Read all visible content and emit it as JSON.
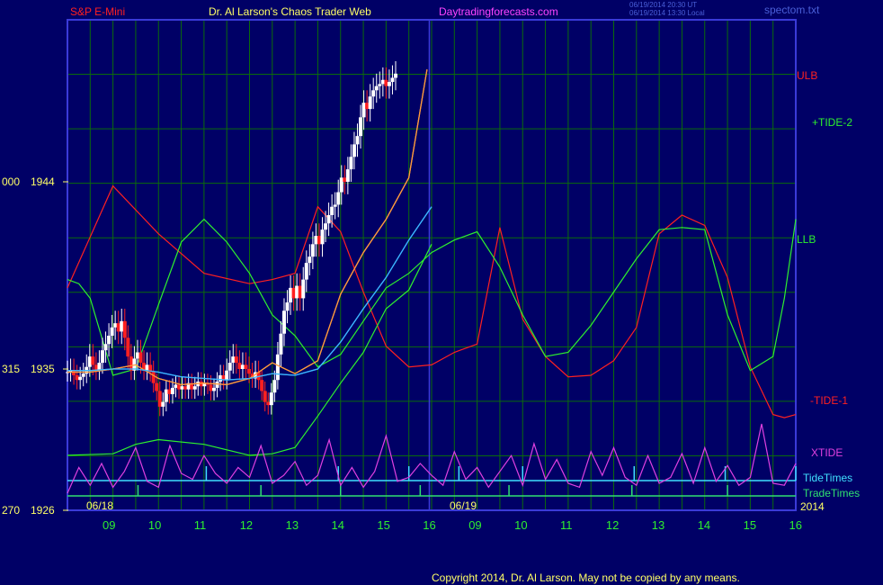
{
  "header": {
    "symbol": "S&P E-Mini",
    "site_title": "Dr. Al Larson's Chaos Trader Web",
    "url": "Daytradingforecasts.com",
    "timestamp_ut": "06/19/2014 20:30 UT",
    "timestamp_local": "06/19/2014 13:30 Local",
    "file": "spectom.txt"
  },
  "footer": {
    "copyright": "Copyright 2014, Dr. Al Larson. May not be copied by any means."
  },
  "colors": {
    "background": "#000066",
    "grid": "#0b6b0b",
    "frame": "#3a3ad8",
    "ulb": "#ff2020",
    "tide": "#2ef02e",
    "xtide": "#e040e0",
    "tide_times": "#40e0ff",
    "trade_times": "#30e070",
    "ma_fast": "#ff9a3c",
    "ma_slow": "#3cb6ff",
    "candle_up": "#ffffff",
    "candle_down": "#ff2020"
  },
  "chart_data": {
    "type": "line",
    "title": "S&P E-Mini",
    "y_ticks": [
      {
        "left": "000",
        "price": "1944",
        "value": 1944
      },
      {
        "left": "315",
        "price": "1935",
        "value": 1935
      },
      {
        "left": "270",
        "price": "1926",
        "value": 1926
      }
    ],
    "ylim": [
      1926,
      1944
    ],
    "date_labels": [
      "06/18",
      "06/19",
      "2014"
    ],
    "hour_labels": [
      "09",
      "10",
      "11",
      "12",
      "13",
      "14",
      "15",
      "16",
      "09",
      "10",
      "11",
      "12",
      "13",
      "14",
      "15",
      "16"
    ],
    "legend": [
      "ULB",
      "+TIDE-2",
      "LLB",
      "-TIDE-1",
      "XTIDE",
      "TideTimes",
      "TradeTimes"
    ],
    "series": [
      {
        "name": "ULB",
        "color": "#ff2020",
        "x": [
          0,
          1,
          2,
          3,
          4,
          4.5,
          5,
          5.5,
          6,
          6.5,
          7,
          7.5,
          8,
          8.5,
          9,
          9.5,
          10,
          10.5,
          11,
          11.5,
          12,
          12.5,
          13,
          13.5,
          14,
          14.5,
          15,
          15.5,
          15.75,
          16
        ],
        "y": [
          1938.9,
          1943.8,
          1941.5,
          1939.6,
          1939.1,
          1939.3,
          1939.6,
          1942.8,
          1941.6,
          1938.7,
          1936.1,
          1935.1,
          1935.2,
          1935.8,
          1936.2,
          1941.8,
          1937.4,
          1935.6,
          1934.5,
          1934.6,
          1935.4,
          1937.0,
          1941.5,
          1942.4,
          1941.9,
          1939.4,
          1935.1,
          1932.1,
          1931.9,
          1932.1
        ]
      },
      {
        "name": "+TIDE-2",
        "color": "#2ef02e",
        "x": [
          0,
          0.25,
          0.5,
          1,
          1.5,
          2,
          2.5,
          3,
          3.5,
          4,
          4.5,
          5,
          5.5,
          6,
          6.5,
          7,
          7.5,
          8,
          8.5,
          9,
          9.5,
          10,
          10.5,
          11,
          11.5,
          12,
          12.5,
          13,
          13.5,
          14,
          14.5,
          15,
          15.5,
          15.75,
          16
        ],
        "y": [
          1939.3,
          1939.1,
          1938.4,
          1934.6,
          1935.0,
          1938.1,
          1941.1,
          1942.2,
          1941.1,
          1939.6,
          1937.6,
          1936.6,
          1935.1,
          1935.7,
          1937.3,
          1938.9,
          1939.6,
          1940.6,
          1941.2,
          1941.6,
          1939.9,
          1937.6,
          1935.6,
          1935.8,
          1937.1,
          1938.7,
          1940.3,
          1941.7,
          1941.8,
          1941.7,
          1937.6,
          1934.9,
          1935.6,
          1938.4,
          1942.2
        ]
      },
      {
        "name": "LLB",
        "color": "#2ef02e",
        "x": [
          0,
          1,
          1.5,
          2,
          3,
          4,
          4.5,
          5,
          5.5,
          6,
          6.5,
          7,
          7.5,
          8
        ],
        "y": [
          1929.5,
          1929.6,
          1930.2,
          1930.5,
          1930.2,
          1929.5,
          1929.6,
          1930.0,
          1932.0,
          1934.1,
          1935.8,
          1937.9,
          1938.8,
          1941.0
        ]
      },
      {
        "name": "MA fast",
        "color": "#ff9a3c",
        "x": [
          0,
          0.5,
          1,
          1.5,
          2,
          2.5,
          3,
          3.5,
          4,
          4.5,
          5,
          5.5,
          5.75,
          6,
          6.5,
          7,
          7.5,
          7.9
        ],
        "y": [
          1934.8,
          1934.8,
          1935.0,
          1935.2,
          1934.4,
          1934.0,
          1934.1,
          1934.0,
          1934.4,
          1935.3,
          1934.7,
          1935.4,
          1937.0,
          1938.6,
          1940.6,
          1942.2,
          1944.2,
          1949.4
        ]
      },
      {
        "name": "MA slow",
        "color": "#3cb6ff",
        "x": [
          0,
          0.5,
          1,
          1.5,
          2,
          2.5,
          3,
          3.5,
          4,
          4.5,
          5,
          5.5,
          6,
          6.5,
          7,
          7.5,
          8
        ],
        "y": [
          1934.9,
          1934.9,
          1935.0,
          1935.0,
          1934.8,
          1934.5,
          1934.4,
          1934.3,
          1934.4,
          1934.7,
          1934.6,
          1935.0,
          1936.3,
          1937.9,
          1939.4,
          1941.2,
          1942.8
        ]
      },
      {
        "name": "XTIDE",
        "color": "#e040e0",
        "x": [
          0,
          0.25,
          0.5,
          0.75,
          1,
          1.25,
          1.5,
          1.75,
          2,
          2.25,
          2.5,
          2.75,
          3,
          3.25,
          3.5,
          3.75,
          4,
          4.25,
          4.5,
          4.75,
          5,
          5.25,
          5.5,
          5.75,
          6,
          6.25,
          6.5,
          6.75,
          7,
          7.25,
          7.5,
          7.75,
          8,
          8.25,
          8.5,
          8.75,
          9,
          9.25,
          9.5,
          9.75,
          10,
          10.25,
          10.5,
          10.75,
          11,
          11.25,
          11.5,
          11.75,
          12,
          12.25,
          12.5,
          12.75,
          13,
          13.25,
          13.5,
          13.75,
          14,
          14.25,
          14.5,
          14.75,
          15,
          15.25,
          15.5,
          15.75,
          16
        ],
        "y": [
          1926.5,
          1927.8,
          1926.9,
          1928.0,
          1926.8,
          1927.6,
          1928.8,
          1927.1,
          1926.8,
          1928.9,
          1927.5,
          1927.2,
          1928.4,
          1927.5,
          1927.0,
          1927.8,
          1927.3,
          1928.9,
          1927.0,
          1927.4,
          1928.1,
          1926.9,
          1927.4,
          1929.2,
          1926.9,
          1927.8,
          1926.8,
          1927.6,
          1929.4,
          1927.1,
          1927.3,
          1928.0,
          1927.4,
          1926.9,
          1928.6,
          1927.2,
          1927.8,
          1926.8,
          1927.6,
          1928.4,
          1926.9,
          1929.0,
          1927.2,
          1928.2,
          1927.0,
          1926.8,
          1928.6,
          1927.4,
          1928.8,
          1927.3,
          1926.9,
          1928.4,
          1927.0,
          1927.3,
          1928.5,
          1927.0,
          1928.8,
          1927.1,
          1927.9,
          1926.9,
          1927.3,
          1930.0,
          1927.0,
          1926.9,
          1928.0
        ]
      }
    ],
    "tide_times": [
      3.05,
      5.95,
      7.5,
      8.6,
      10.0,
      12.45,
      14.45,
      16.0
    ],
    "trade_times": [
      1.55,
      4.25,
      6.0,
      7.75,
      9.7,
      12.4,
      14.5
    ],
    "candles": {
      "x_start": 0,
      "x_step": 0.07,
      "close": [
        1934.8,
        1934.9,
        1934.6,
        1934.3,
        1934.5,
        1934.7,
        1935.1,
        1935.6,
        1935.2,
        1934.9,
        1935.3,
        1935.9,
        1936.2,
        1936.6,
        1937.0,
        1937.2,
        1936.8,
        1937.3,
        1936.5,
        1935.6,
        1934.9,
        1935.5,
        1935.8,
        1935.3,
        1934.9,
        1935.2,
        1934.8,
        1934.1,
        1933.6,
        1932.6,
        1932.9,
        1933.7,
        1933.4,
        1933.8,
        1934.0,
        1933.7,
        1933.9,
        1933.7,
        1934.1,
        1933.7,
        1933.9,
        1934.2,
        1933.9,
        1934.1,
        1934.0,
        1933.6,
        1933.8,
        1934.2,
        1934.6,
        1934.3,
        1934.9,
        1935.3,
        1935.6,
        1935.3,
        1935.0,
        1935.2,
        1935.0,
        1934.7,
        1934.4,
        1934.8,
        1934.3,
        1933.6,
        1932.9,
        1932.7,
        1933.5,
        1934.3,
        1935.7,
        1936.7,
        1937.8,
        1938.2,
        1938.9,
        1938.4,
        1939.0,
        1938.4,
        1939.3,
        1940.1,
        1940.4,
        1941.0,
        1941.4,
        1941.0,
        1941.7,
        1942.0,
        1942.4,
        1942.8,
        1942.9,
        1943.5,
        1944.2,
        1944.0,
        1944.6,
        1945.2,
        1945.8,
        1946.2,
        1947.1,
        1947.8,
        1947.5,
        1948.1,
        1948.4,
        1948.6,
        1948.7,
        1948.9,
        1948.6,
        1948.8,
        1949.0,
        1949.2
      ],
      "high_pad": 0.6,
      "low_pad": 0.6
    }
  }
}
